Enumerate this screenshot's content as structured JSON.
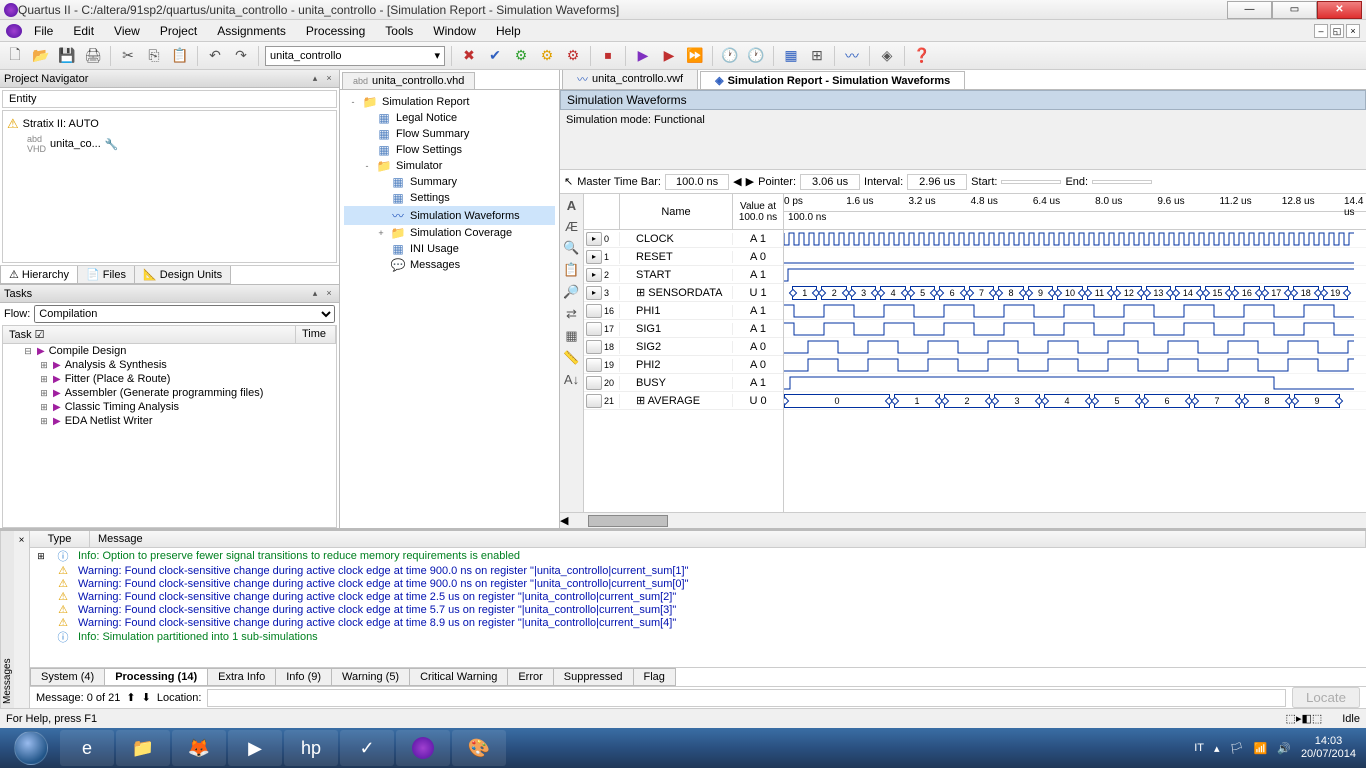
{
  "title": "Quartus II - C:/altera/91sp2/quartus/unita_controllo - unita_controllo - [Simulation Report - Simulation Waveforms]",
  "menus": [
    "File",
    "Edit",
    "View",
    "Project",
    "Assignments",
    "Processing",
    "Tools",
    "Window",
    "Help"
  ],
  "toolbar_combo": "unita_controllo",
  "project_navigator": {
    "header": "Project Navigator",
    "entity_header": "Entity",
    "device": "Stratix II: AUTO",
    "entity": "unita_co...",
    "tabs": [
      "Hierarchy",
      "Files",
      "Design Units"
    ]
  },
  "tasks": {
    "header": "Tasks",
    "flow_label": "Flow:",
    "flow_value": "Compilation",
    "col_task": "Task",
    "col_time": "Time",
    "rows": [
      "Compile Design",
      "Analysis & Synthesis",
      "Fitter (Place & Route)",
      "Assembler (Generate programming files)",
      "Classic Timing Analysis",
      "EDA Netlist Writer"
    ]
  },
  "file_tabs": {
    "vhd": "unita_controllo.vhd",
    "vwf": "unita_controllo.vwf",
    "report": "Simulation Report - Simulation Waveforms"
  },
  "report_tree": [
    {
      "label": "Simulation Report",
      "icon": "folder",
      "exp": "-",
      "depth": 0
    },
    {
      "label": "Legal Notice",
      "icon": "doc",
      "depth": 1
    },
    {
      "label": "Flow Summary",
      "icon": "tbl",
      "depth": 1
    },
    {
      "label": "Flow Settings",
      "icon": "tbl",
      "depth": 1
    },
    {
      "label": "Simulator",
      "icon": "folder",
      "exp": "-",
      "depth": 1
    },
    {
      "label": "Summary",
      "icon": "tbl",
      "depth": 2
    },
    {
      "label": "Settings",
      "icon": "tbl",
      "depth": 2
    },
    {
      "label": "Simulation Waveforms",
      "icon": "wave",
      "depth": 2,
      "sel": true
    },
    {
      "label": "Simulation Coverage",
      "icon": "folder",
      "exp": "+",
      "depth": 2
    },
    {
      "label": "INI Usage",
      "icon": "tbl",
      "depth": 2
    },
    {
      "label": "Messages",
      "icon": "msg",
      "depth": 2
    }
  ],
  "waveform": {
    "header": "Simulation Waveforms",
    "mode": "Simulation mode: Functional",
    "timebar_label": "Master Time Bar:",
    "timebar_value": "100.0 ns",
    "pointer_label": "Pointer:",
    "pointer_value": "3.06 us",
    "interval_label": "Interval:",
    "interval_value": "2.96 us",
    "start_label": "Start:",
    "start_value": "",
    "end_label": "End:",
    "end_value": "",
    "name_hdr": "Name",
    "value_hdr": "Value at 100.0 ns",
    "ruler2": "100.0 ns",
    "ticks": [
      "0 ps",
      "1.6 us",
      "3.2 us",
      "4.8 us",
      "6.4 us",
      "8.0 us",
      "9.6 us",
      "11.2 us",
      "12.8 us",
      "14.4 us"
    ],
    "signals": [
      {
        "idx": "0",
        "name": "CLOCK",
        "val": "A 1",
        "type": "clock"
      },
      {
        "idx": "1",
        "name": "RESET",
        "val": "A 0",
        "type": "low"
      },
      {
        "idx": "2",
        "name": "START",
        "val": "A 1",
        "type": "high"
      },
      {
        "idx": "3",
        "name": "SENSORDATA",
        "val": "U 1",
        "type": "bus",
        "exp": true
      },
      {
        "idx": "16",
        "name": "PHI1",
        "val": "A 1",
        "type": "phi1"
      },
      {
        "idx": "17",
        "name": "SIG1",
        "val": "A 1",
        "type": "sig1"
      },
      {
        "idx": "18",
        "name": "SIG2",
        "val": "A 0",
        "type": "sig2"
      },
      {
        "idx": "19",
        "name": "PHI2",
        "val": "A 0",
        "type": "phi2"
      },
      {
        "idx": "20",
        "name": "BUSY",
        "val": "A 1",
        "type": "busy"
      },
      {
        "idx": "21",
        "name": "AVERAGE",
        "val": "U 0",
        "type": "bus2",
        "exp": true
      }
    ],
    "sensordata_values": [
      "1",
      "2",
      "3",
      "4",
      "5",
      "6",
      "7",
      "8",
      "9",
      "10",
      "11",
      "12",
      "13",
      "14",
      "15",
      "16",
      "17",
      "18",
      "19"
    ],
    "average_values": [
      "0",
      "1",
      "2",
      "3",
      "4",
      "5",
      "6",
      "7",
      "8",
      "9"
    ]
  },
  "messages": {
    "type_hdr": "Type",
    "msg_hdr": "Message",
    "rows": [
      {
        "kind": "info",
        "text": "Info: Option to preserve fewer signal transitions to reduce memory requirements is enabled"
      },
      {
        "kind": "warn",
        "text": "Warning: Found clock-sensitive change during active clock edge at time 900.0 ns on register \"|unita_controllo|current_sum[1]\""
      },
      {
        "kind": "warn",
        "text": "Warning: Found clock-sensitive change during active clock edge at time 900.0 ns on register \"|unita_controllo|current_sum[0]\""
      },
      {
        "kind": "warn",
        "text": "Warning: Found clock-sensitive change during active clock edge at time 2.5 us on register \"|unita_controllo|current_sum[2]\""
      },
      {
        "kind": "warn",
        "text": "Warning: Found clock-sensitive change during active clock edge at time 5.7 us on register \"|unita_controllo|current_sum[3]\""
      },
      {
        "kind": "warn",
        "text": "Warning: Found clock-sensitive change during active clock edge at time 8.9 us on register \"|unita_controllo|current_sum[4]\""
      },
      {
        "kind": "info",
        "text": "Info: Simulation partitioned into 1 sub-simulations"
      }
    ],
    "tabs": [
      "System (4)",
      "Processing (14)",
      "Extra Info",
      "Info (9)",
      "Warning (5)",
      "Critical Warning",
      "Error",
      "Suppressed",
      "Flag"
    ],
    "active_tab": 1,
    "count": "Message: 0 of 21",
    "location_label": "Location:",
    "locate_btn": "Locate"
  },
  "statusbar": {
    "help": "For Help, press F1",
    "status": "Idle"
  },
  "taskbar": {
    "lang": "IT",
    "time": "14:03",
    "date": "20/07/2014"
  }
}
